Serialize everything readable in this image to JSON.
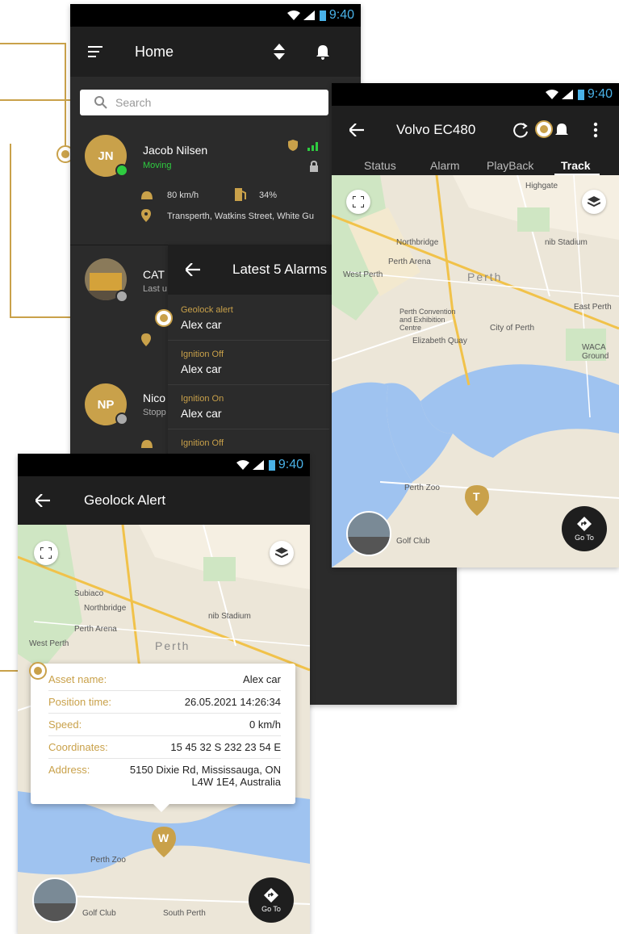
{
  "status_time": "9:40",
  "home": {
    "title": "Home",
    "search_placeholder": "Search",
    "assets": [
      {
        "initials": "JN",
        "name": "Jacob Nilsen",
        "state": "Moving",
        "speed": "80 km/h",
        "fuel": "34%",
        "address": "Transperth, Watkins Street, White Gu"
      },
      {
        "name": "CAT",
        "state": "Last u"
      },
      {
        "initials": "NP",
        "name": "Nico",
        "state": "Stopp"
      }
    ]
  },
  "alarms": {
    "title": "Latest 5 Alarms",
    "items": [
      {
        "type": "Geolock alert",
        "asset": "Alex car"
      },
      {
        "type": "Ignition Off",
        "asset": "Alex car"
      },
      {
        "type": "Ignition On",
        "asset": "Alex car"
      },
      {
        "type": "Ignition Off",
        "asset": ""
      }
    ]
  },
  "track": {
    "title": "Volvo EC480",
    "tabs": [
      "Status",
      "Alarm",
      "PlayBack",
      "Track"
    ],
    "active_tab": "Track",
    "marker": "T",
    "goto_label": "Go To",
    "map_labels": [
      "Perth",
      "Perth Arena",
      "West Perth",
      "Perth Convention and Exhibition Centre",
      "City of Perth",
      "Elizabeth Quay",
      "Perth Zoo",
      "East Perth",
      "Golf Club",
      "nib Stadium",
      "Northbridge",
      "Highgate",
      "WACA Ground"
    ]
  },
  "geolock": {
    "title": "Geolock Alert",
    "fields": [
      {
        "k": "Asset name:",
        "v": "Alex car"
      },
      {
        "k": "Position time:",
        "v": "26.05.2021 14:26:34"
      },
      {
        "k": "Speed:",
        "v": "0 km/h"
      },
      {
        "k": "Coordinates:",
        "v": "15 45 32 S 232 23 54 E"
      },
      {
        "k": "Address:",
        "v": "5150 Dixie Rd, Mississauga, ON L4W 1E4, Australia"
      }
    ],
    "marker": "W",
    "goto_label": "Go To",
    "map_labels": [
      "Perth",
      "Perth Arena",
      "West Perth",
      "Northbridge",
      "nib Stadium",
      "Perth Zoo",
      "Subiaco",
      "South Perth",
      "Golf Club"
    ]
  }
}
